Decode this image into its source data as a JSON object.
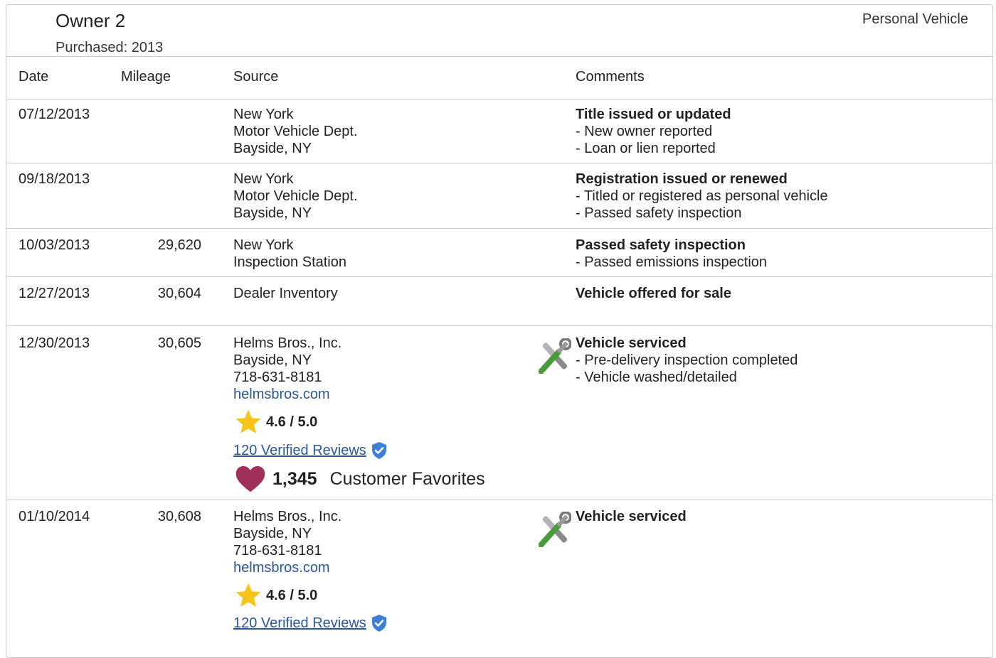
{
  "owner": {
    "title": "Owner 2",
    "purchased": "Purchased: 2013",
    "vehicle_type": "Personal Vehicle"
  },
  "columns": {
    "date": "Date",
    "mileage": "Mileage",
    "source": "Source",
    "comments": "Comments"
  },
  "rows": [
    {
      "date": "07/12/2013",
      "mileage": "",
      "source": [
        "New York",
        "Motor Vehicle Dept.",
        "Bayside, NY"
      ],
      "comment_title": "Title issued or updated",
      "comment_items": [
        "- New owner reported",
        "- Loan or lien reported"
      ]
    },
    {
      "date": "09/18/2013",
      "mileage": "",
      "source": [
        "New York",
        "Motor Vehicle Dept.",
        "Bayside, NY"
      ],
      "comment_title": "Registration issued or renewed",
      "comment_items": [
        "- Titled or registered as personal vehicle",
        "- Passed safety inspection"
      ]
    },
    {
      "date": "10/03/2013",
      "mileage": "29,620",
      "source": [
        "New York",
        "Inspection Station"
      ],
      "comment_title": "Passed safety inspection",
      "comment_items": [
        "- Passed emissions inspection"
      ]
    },
    {
      "date": "12/27/2013",
      "mileage": "30,604",
      "source": [
        "Dealer Inventory"
      ],
      "comment_title": "Vehicle offered for sale",
      "comment_items": []
    },
    {
      "date": "12/30/2013",
      "mileage": "30,605",
      "source": [
        "Helms Bros., Inc.",
        "Bayside, NY",
        "718-631-8181"
      ],
      "website": "helmsbros.com",
      "rating": "4.6 / 5.0",
      "reviews": "120 Verified Reviews",
      "favorites_count": "1,345",
      "favorites_label": "Customer Favorites",
      "comment_icon": "service-tools-icon",
      "comment_title": "Vehicle serviced",
      "comment_items": [
        "- Pre-delivery inspection completed",
        "- Vehicle washed/detailed"
      ]
    },
    {
      "date": "01/10/2014",
      "mileage": "30,608",
      "source": [
        "Helms Bros., Inc.",
        "Bayside, NY",
        "718-631-8181"
      ],
      "website": "helmsbros.com",
      "rating": "4.6 / 5.0",
      "reviews": "120 Verified Reviews",
      "comment_icon": "service-tools-icon",
      "comment_title": "Vehicle serviced",
      "comment_items": []
    }
  ],
  "colors": {
    "link": "#2b5797",
    "star": "#f5c518",
    "heart": "#a0305a",
    "verified": "#3d7fd6",
    "border": "#c9c9c9"
  }
}
